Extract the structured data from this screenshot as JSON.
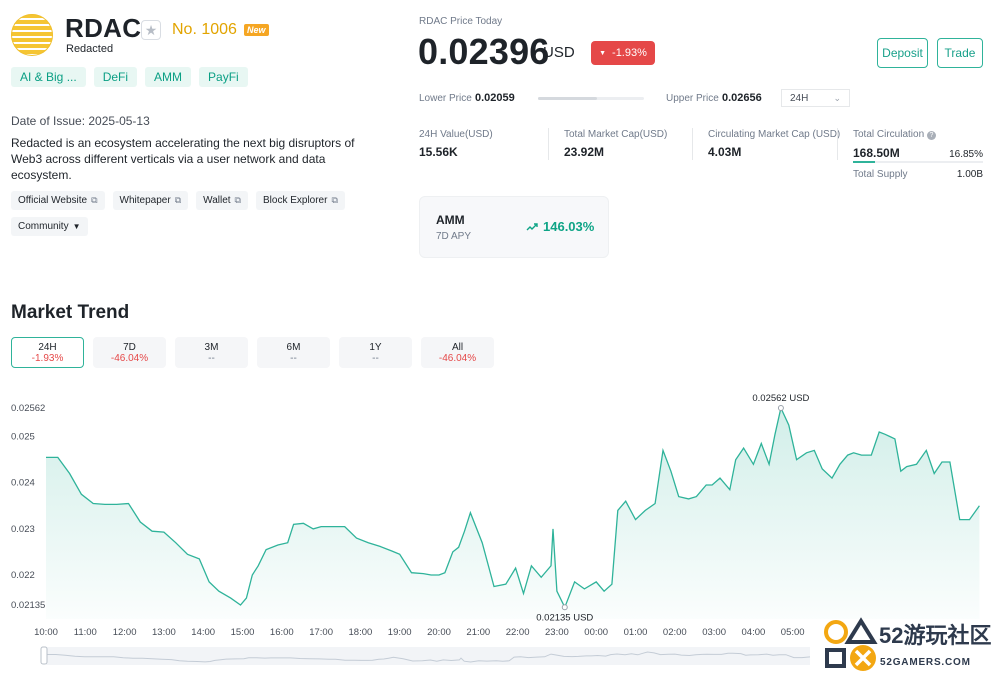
{
  "coin": {
    "symbol": "RDAC",
    "name": "Redacted",
    "rank": "No. 1006",
    "badge": "New",
    "tags": [
      "AI & Big ...",
      "DeFi",
      "AMM",
      "PayFi"
    ],
    "issue_date": "Date of Issue: 2025-05-13",
    "description": "Redacted is an ecosystem accelerating the next big disruptors of Web3 across different verticals via a user network and data ecosystem.",
    "links": [
      "Official Website",
      "Whitepaper",
      "Wallet",
      "Block Explorer"
    ],
    "community": "Community"
  },
  "price": {
    "label": "RDAC Price Today",
    "value": "0.02396",
    "unit": "USD",
    "change": "-1.93%",
    "lower_label": "Lower Price",
    "lower": "0.02059",
    "upper_label": "Upper Price",
    "upper": "0.02656",
    "range_select": "24H",
    "range_position": 0.56
  },
  "actions": {
    "deposit": "Deposit",
    "trade": "Trade"
  },
  "stats": {
    "value_24h_label": "24H Value(USD)",
    "value_24h": "15.56K",
    "mcap_label": "Total Market Cap(USD)",
    "mcap": "23.92M",
    "circ_mcap_label": "Circulating Market Cap (USD)",
    "circ_mcap": "4.03M",
    "circ_label": "Total Circulation",
    "circ": "168.50M",
    "circ_pct": "16.85%",
    "circ_fraction": 0.1685,
    "supply_label": "Total Supply",
    "supply": "1.00B"
  },
  "apy": {
    "pool": "AMM",
    "label": "7D APY",
    "value": "146.03%"
  },
  "trend": {
    "title": "Market Trend",
    "tabs": [
      {
        "label": "24H",
        "change": "-1.93%"
      },
      {
        "label": "7D",
        "change": "-46.04%"
      },
      {
        "label": "3M",
        "change": "--"
      },
      {
        "label": "6M",
        "change": "--"
      },
      {
        "label": "1Y",
        "change": "--"
      },
      {
        "label": "All",
        "change": "-46.04%"
      }
    ]
  },
  "colors": {
    "accent": "#2fb39a",
    "negative": "#e54848",
    "brand": "#f5c533"
  },
  "chart_data": {
    "type": "area",
    "y_ticks": [
      "0.02562",
      "0.025",
      "0.024",
      "0.023",
      "0.022",
      "0.02135"
    ],
    "x_ticks": [
      "10:00",
      "11:00",
      "12:00",
      "13:00",
      "14:00",
      "15:00",
      "16:00",
      "17:00",
      "18:00",
      "19:00",
      "20:00",
      "21:00",
      "22:00",
      "23:00",
      "00:00",
      "01:00",
      "02:00",
      "03:00",
      "04:00",
      "05:00"
    ],
    "ylim": [
      0.02135,
      0.02562
    ],
    "max_label": "0.02562  USD",
    "min_label": "0.02135  USD",
    "series": [
      {
        "t": [
          0,
          0.3,
          0.6,
          0.9,
          1.2,
          1.5,
          1.8,
          2.1,
          2.4,
          2.7,
          3.0,
          3.3,
          3.6,
          3.9,
          4.15,
          4.4,
          4.7,
          4.95,
          5.1,
          5.25,
          5.4,
          5.6,
          5.9,
          6.15,
          6.3,
          6.55,
          6.8,
          7.0,
          7.3,
          7.6,
          7.9,
          8.2,
          8.5,
          8.8,
          9.0,
          9.3,
          9.6,
          9.8,
          10.0,
          10.15,
          10.35,
          10.5,
          10.65,
          10.8,
          11.1,
          11.4,
          11.7,
          11.95,
          12.15,
          12.35,
          12.6,
          12.85,
          12.9,
          13.0,
          13.2,
          13.45,
          13.7,
          14.0,
          14.2,
          14.4,
          14.55,
          14.75,
          15.0,
          15.25,
          15.5,
          15.7,
          15.9,
          16.1,
          16.35,
          16.55,
          16.8,
          16.95,
          17.15,
          17.4,
          17.55,
          17.75,
          18.0,
          18.2,
          18.4,
          18.55,
          18.7,
          18.9,
          19.1,
          19.35,
          19.55,
          19.75,
          20.0,
          20.2,
          20.4,
          20.55,
          20.75,
          21.0,
          21.2,
          21.35,
          21.6,
          21.75,
          21.9,
          22.15,
          22.4,
          22.6,
          22.8,
          23.0,
          23.25,
          23.5,
          23.75
        ],
        "y": [
          0.02455,
          0.02455,
          0.0242,
          0.02375,
          0.02355,
          0.02353,
          0.02353,
          0.02355,
          0.02315,
          0.02295,
          0.02293,
          0.0227,
          0.02245,
          0.02235,
          0.02185,
          0.02165,
          0.0215,
          0.02135,
          0.0215,
          0.022,
          0.0222,
          0.02255,
          0.02265,
          0.0227,
          0.0231,
          0.02312,
          0.023,
          0.02305,
          0.02305,
          0.02305,
          0.0228,
          0.0227,
          0.02262,
          0.02252,
          0.02245,
          0.02205,
          0.02203,
          0.022,
          0.022,
          0.02205,
          0.0225,
          0.0226,
          0.02295,
          0.02335,
          0.0227,
          0.02175,
          0.0218,
          0.02215,
          0.0216,
          0.0222,
          0.02195,
          0.0222,
          0.023,
          0.02165,
          0.0213,
          0.02185,
          0.0217,
          0.02185,
          0.02165,
          0.0218,
          0.0234,
          0.0236,
          0.0232,
          0.0234,
          0.02355,
          0.0247,
          0.02425,
          0.0237,
          0.02365,
          0.0237,
          0.02395,
          0.02395,
          0.0241,
          0.02385,
          0.0245,
          0.02475,
          0.0244,
          0.02485,
          0.0244,
          0.02505,
          0.02562,
          0.02525,
          0.0245,
          0.02465,
          0.0247,
          0.0243,
          0.0241,
          0.0244,
          0.0246,
          0.02465,
          0.0246,
          0.0246,
          0.0251,
          0.02505,
          0.02495,
          0.02425,
          0.02435,
          0.0244,
          0.0247,
          0.0242,
          0.02445,
          0.02445,
          0.0232,
          0.0232,
          0.0235
        ]
      }
    ]
  }
}
